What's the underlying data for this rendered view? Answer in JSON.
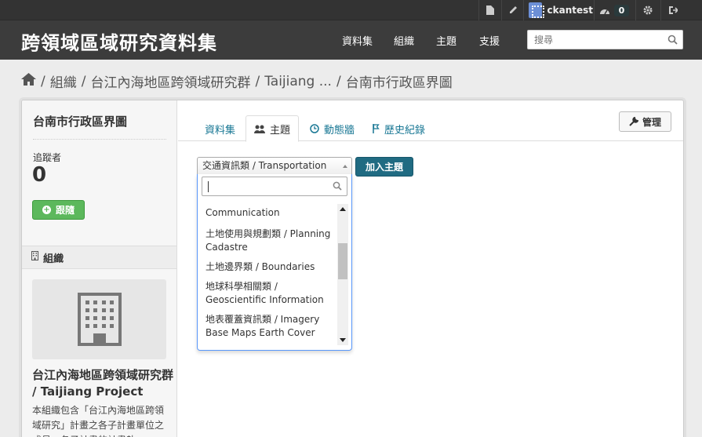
{
  "account": {
    "username": "ckantest",
    "activity_count": "0"
  },
  "masthead": {
    "site_title": "跨領域區域研究資料集",
    "nav": [
      "資料集",
      "組織",
      "主題",
      "支援"
    ],
    "search_placeholder": "搜尋"
  },
  "breadcrumb": {
    "sep": "/",
    "items": [
      "組織",
      "台江內海地區跨領域研究群",
      "Taijiang ...",
      "台南市行政區界圖"
    ]
  },
  "sidebar": {
    "title": "台南市行政區界圖",
    "followers_label": "追蹤者",
    "followers_count": "0",
    "follow_button": "跟隨",
    "org_section_label": "組織",
    "org_name": "台江內海地區跨領域研究群 / Taijiang Project",
    "org_description": "本組織包含「台江內海地區跨領域研究」計畫之各子計畫單位之成員，各子計畫的計畫執"
  },
  "tabs": [
    {
      "label": "資料集",
      "icon": "none"
    },
    {
      "label": "主題",
      "icon": "users-icon",
      "active": true
    },
    {
      "label": "動態牆",
      "icon": "clock-icon"
    },
    {
      "label": "歷史紀錄",
      "icon": "flag-icon"
    }
  ],
  "manage_button": "管理",
  "topic_select": {
    "selected": "交通資訊類 / Transportation",
    "add_button": "加入主題",
    "options": [
      "Communication",
      "土地使用與規劃類 / Planning Cadastre",
      "土地邊界類 / Boundaries",
      "地球科學相關類 / Geoscientific Information",
      "地表覆蓋資訊類 / Imagery Base Maps Earth Cover"
    ]
  },
  "colors": {
    "masthead": "#3c3c3c",
    "account_bar": "#333333",
    "link": "#187794",
    "follow_green": "#5cb85c",
    "primary_button": "#206b82",
    "dropdown_border": "#5897fb"
  }
}
